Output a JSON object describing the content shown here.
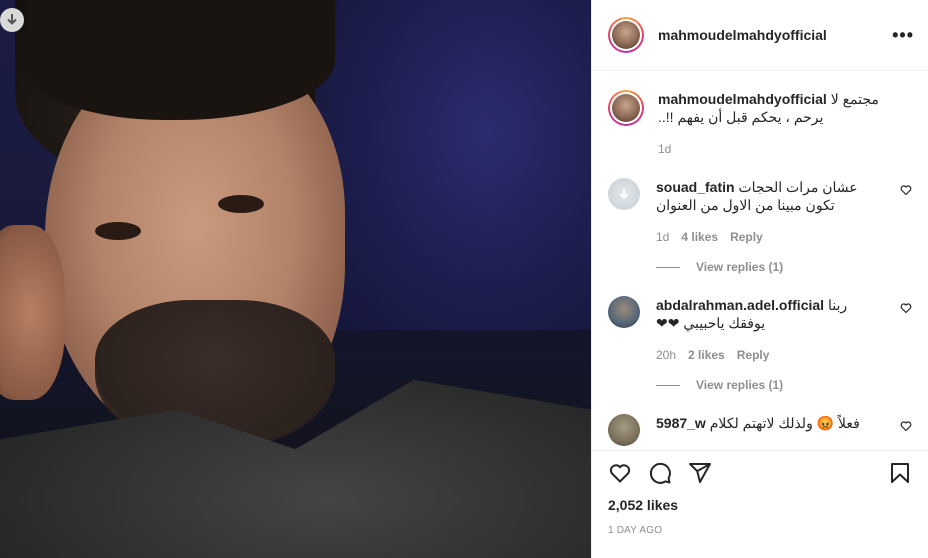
{
  "post": {
    "username": "mahmoudelmahdyofficial",
    "more_label": "•••",
    "caption_username": "mahmoudelmahdyofficial",
    "caption_text": "مجتمع لا يرحم ، يحكم قبل أن يفهم !!..",
    "caption_age": "1d"
  },
  "comments": [
    {
      "username": "souad_fatin",
      "text": "عشان مرات الحجات تكون مبينا من الاول من العنوان",
      "age": "1d",
      "likes": "4 likes",
      "reply_label": "Reply",
      "view_replies": "View replies (1)"
    },
    {
      "username": "abdalrahman.adel.official",
      "text": "ربنا يوفقك ياحبيبي ❤❤",
      "age": "20h",
      "likes": "2 likes",
      "reply_label": "Reply",
      "view_replies": "View replies (1)"
    },
    {
      "username": "5987_w",
      "text": "فعلاً 😡 ولذلك لاتهتم لكلام"
    }
  ],
  "footer": {
    "likes": "2,052 likes",
    "date": "1 DAY AGO"
  },
  "icons": {
    "download": "download-arrow-icon",
    "like": "heart-icon",
    "comment": "comment-bubble-icon",
    "share": "paper-plane-icon",
    "save": "bookmark-icon"
  }
}
